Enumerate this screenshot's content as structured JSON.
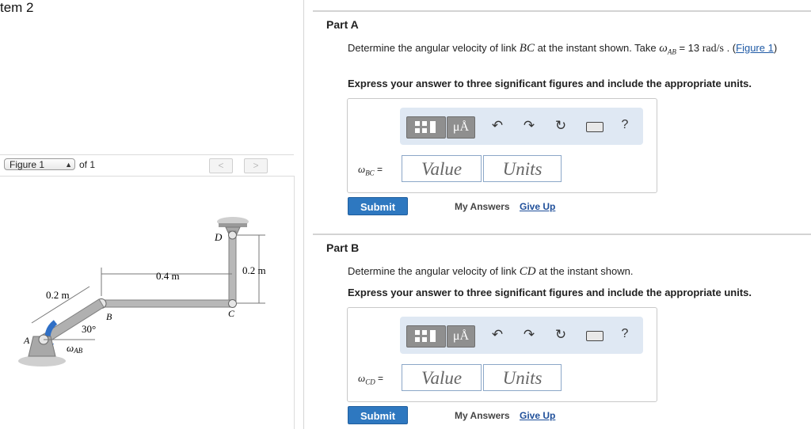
{
  "item_title": "tem 2",
  "figure_panel": {
    "select_value": "Figure 1",
    "of_label": "of 1",
    "prev_label": "<",
    "next_label": ">",
    "figure_labels": {
      "d": "D",
      "a": "A",
      "b": "B",
      "c": "C",
      "len_04": "0.4 m",
      "len_02_left": "0.2 m",
      "len_02_right": "0.2 m",
      "angle": "30°",
      "omega_ab": "ω",
      "omega_ab_sub": "AB"
    }
  },
  "parts": [
    {
      "title": "Part A",
      "question": {
        "pre": "Determine the angular velocity of link ",
        "var": "BC",
        "mid": " at the instant shown. Take ",
        "omega": "ω",
        "omega_sub": "AB",
        "eq": " = 13 ",
        "unit": "rad/s",
        "post": " . (",
        "link": "Figure 1",
        "close": ")"
      },
      "instruction": "Express your answer to three significant figures and include the appropriate units.",
      "answer_label": "ω",
      "answer_label_sub": "BC",
      "answer_label_eq": " =",
      "value_placeholder": "Value",
      "units_placeholder": "Units",
      "submit": "Submit",
      "my_answers": "My Answers",
      "give_up": "Give Up"
    },
    {
      "title": "Part B",
      "question": {
        "pre": "Determine the angular velocity of link ",
        "var": "CD",
        "post": " at the instant shown."
      },
      "instruction": "Express your answer to three significant figures and include the appropriate units.",
      "answer_label": "ω",
      "answer_label_sub": "CD",
      "answer_label_eq": " =",
      "value_placeholder": "Value",
      "units_placeholder": "Units",
      "submit": "Submit",
      "my_answers": "My Answers",
      "give_up": "Give Up"
    }
  ],
  "toolbar": {
    "template_icon": "template-icon",
    "units_label": "μÅ",
    "undo_icon": "undo-icon",
    "redo_icon": "redo-icon",
    "reset_icon": "reset-icon",
    "keyboard_icon": "keyboard-icon",
    "help_label": "?"
  },
  "colors": {
    "submit": "#2e78c0",
    "toolbar_bg": "#dfe8f3",
    "link": "#1f5aa6",
    "omega_arrow": "#2f6fc6"
  }
}
